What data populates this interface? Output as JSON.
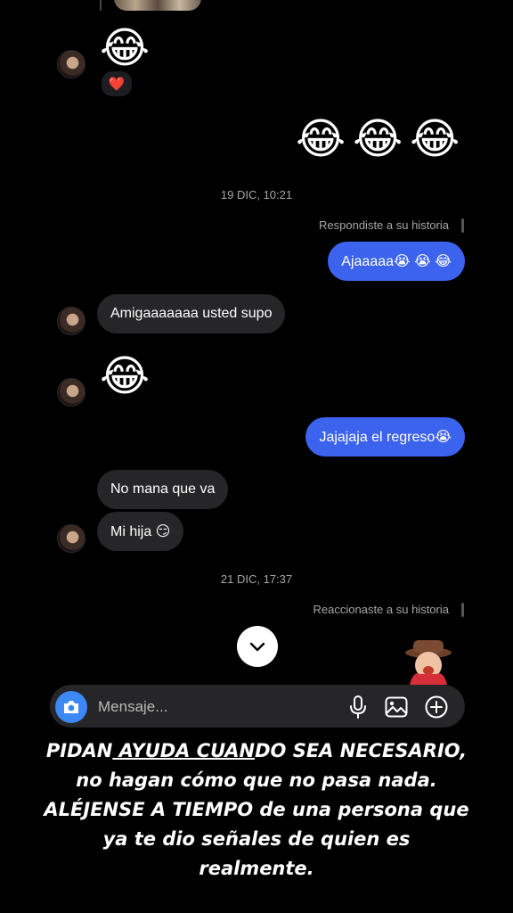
{
  "thread": {
    "top_reaction": "❤️",
    "received_emoji_1": "😂",
    "sent_emojis": "😂😂😂",
    "timestamp_1": "19 DIC, 10:21",
    "reply_note_1": "Respondiste a su historia",
    "msg_out_1": "Ajaaaaa😭 😭 😂",
    "msg_in_1": "Amigaaaaaaa usted supo",
    "received_emoji_2": "😂",
    "msg_out_2": "Jajajaja el regreso😭",
    "msg_in_2": "No mana que va",
    "msg_in_3": "Mi hija 😏",
    "timestamp_2": "21 DIC, 17:37",
    "reply_note_2": "Reaccionaste a su historia"
  },
  "composer": {
    "placeholder": "Mensaje..."
  },
  "icons": {
    "camera": "camera-icon",
    "mic": "microphone-icon",
    "gallery": "image-icon",
    "add": "plus-circle-icon",
    "scroll": "chevron-down-icon"
  },
  "caption": {
    "part1": "PIDAN",
    "part2": " AYUDA CUAN",
    "part3": "DO SEA NECESARIO,",
    "part4": " no hagan cómo que no pasa nada. ",
    "part5": "ALÉJENSE A TIEMPO",
    "part6": " de una persona que ya te dio señales de quien es realmente."
  },
  "colors": {
    "background": "#000000",
    "sent_bubble": "#3c63ee",
    "received_bubble": "#262628",
    "camera_button": "#3c88f5"
  }
}
